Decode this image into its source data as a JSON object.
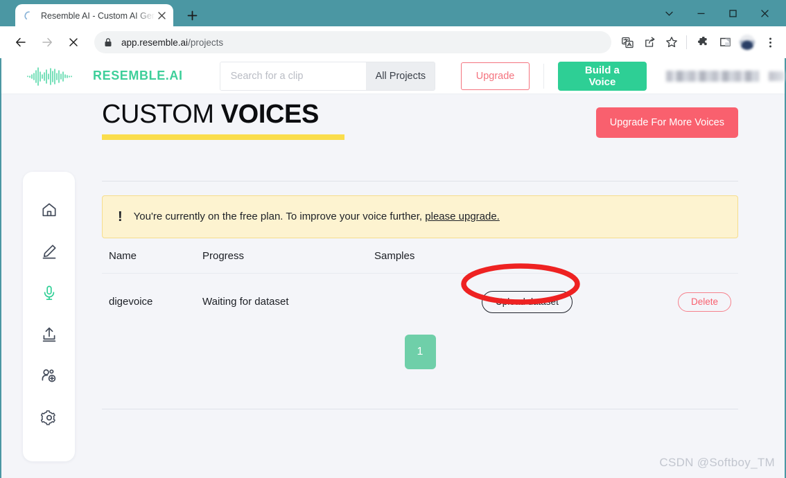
{
  "browser": {
    "tab": {
      "title": "Resemble AI - Custom AI Gene",
      "favicon": "loading-spinner-icon",
      "close": "×"
    },
    "new_tab_label": "+",
    "window_controls": [
      {
        "name": "tab-search-chevron",
        "glyph": "⌄"
      },
      {
        "name": "minimize",
        "glyph": "—"
      },
      {
        "name": "maximize",
        "glyph": "□"
      },
      {
        "name": "close",
        "glyph": "✕"
      }
    ],
    "nav": {
      "back": "←",
      "forward": "→",
      "stop": "✕"
    },
    "omnibox": {
      "host": "app.resemble.ai",
      "path": "/projects",
      "lock": "lock-icon"
    },
    "toolbar_icons": [
      "translate-icon",
      "share-icon",
      "bookmark-star-icon",
      "extensions-puzzle-icon",
      "cast-device-icon",
      "profile-avatar",
      "more-vertical-icon"
    ]
  },
  "app_header": {
    "logo_text": "RESEMBLE.AI",
    "search": {
      "placeholder": "Search for a clip",
      "value": "",
      "scope": "All Projects",
      "icon": "search-icon"
    },
    "upgrade_label": "Upgrade",
    "build_voice_label": "Build a Voice"
  },
  "sidebar": {
    "items": [
      {
        "name": "sidebar-item-home",
        "icon": "home-icon",
        "active": false
      },
      {
        "name": "sidebar-item-edit",
        "icon": "pencil-icon",
        "active": false
      },
      {
        "name": "sidebar-item-voices",
        "icon": "microphone-icon",
        "active": true
      },
      {
        "name": "sidebar-item-upload",
        "icon": "upload-icon",
        "active": false
      },
      {
        "name": "sidebar-item-team",
        "icon": "add-user-icon",
        "active": false
      },
      {
        "name": "sidebar-item-settings",
        "icon": "gear-icon",
        "active": false
      }
    ]
  },
  "main": {
    "title_light": "CUSTOM ",
    "title_bold": "VOICES",
    "upgrade_more_label": "Upgrade For More Voices",
    "alert": {
      "bang": "!",
      "text": "You're currently on the free plan. To improve your voice further, ",
      "link": "please upgrade."
    },
    "table": {
      "headers": [
        "Name",
        "Progress",
        "Samples",
        "",
        ""
      ],
      "rows": [
        {
          "name": "digevoice",
          "progress": "Waiting for dataset",
          "samples": "",
          "upload_label": "Upload dataset",
          "delete_label": "Delete"
        }
      ]
    },
    "pagination": {
      "current": "1"
    }
  },
  "annotation": {
    "type": "red-ellipse-highlight",
    "target": "upload-dataset-button",
    "color": "#ee2222"
  },
  "watermark": "CSDN @Softboy_TM",
  "colors": {
    "titlebar": "#4b97a3",
    "brand_green": "#2ecf95",
    "accent_red": "#f9606e",
    "alert_bg": "#fdf3d0",
    "alert_border": "#f6dd8d",
    "underline_yellow": "#fadd4c",
    "page_bg": "#f4f5f9",
    "pager_green": "#6fcfa9"
  }
}
